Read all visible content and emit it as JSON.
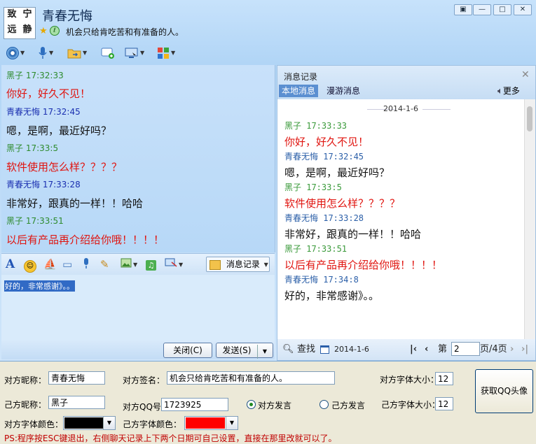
{
  "window": {
    "avatar_chars": [
      "致",
      "宁",
      "远",
      "静"
    ],
    "contact_name": "青春无悔",
    "contact_signature": "机会只给肯吃苦和有准备的人。",
    "controls": [
      "▣",
      "—",
      "□",
      "✕"
    ]
  },
  "toolbar": {
    "icons": [
      "camera-icon",
      "microphone-icon",
      "file-transfer-icon",
      "sms-icon",
      "remote-desktop-icon",
      "apps-icon"
    ]
  },
  "chat": {
    "messages": [
      {
        "meta": "黑子 17:32:33",
        "text": "你好，好久不见！",
        "meta_color": "#2e8b2e",
        "text_color": "#e0140f"
      },
      {
        "meta": "青春无悔 17:32:45",
        "text": "嗯，是啊，最近好吗？",
        "meta_color": "#1a2fb0",
        "text_color": "#111111"
      },
      {
        "meta": "黑子 17:33:5",
        "text": "软件使用怎么样？？？？",
        "meta_color": "#2e8b2e",
        "text_color": "#e0140f"
      },
      {
        "meta": "青春无悔 17:33:28",
        "text": "非常好，跟真的一样！！哈哈",
        "meta_color": "#1a2fb0",
        "text_color": "#111111"
      },
      {
        "meta": "黑子 17:33:51",
        "text": "以后有产品再介绍给你哦！！！！",
        "meta_color": "#2e8b2e",
        "text_color": "#e0140f"
      }
    ],
    "message_record_label": "消息记录",
    "input_text": "好的，非常感谢》。。",
    "close_label": "关闭(C)",
    "send_label": "发送(S)"
  },
  "history": {
    "title": "消息记录",
    "tab_local": "本地消息",
    "tab_roam": "漫游消息",
    "more": "更多",
    "date": "2014-1-6",
    "messages": [
      {
        "meta": "黑子  17:33:33",
        "text": "你好，好久不见！",
        "meta_color": "#3a9a3a",
        "text_color": "#e0140f"
      },
      {
        "meta": "青春无悔  17:32:45",
        "text": "嗯，是啊，最近好吗？",
        "meta_color": "#2b5fa8",
        "text_color": "#111111"
      },
      {
        "meta": "黑子  17:33:5",
        "text": "软件使用怎么样？？？？",
        "meta_color": "#3a9a3a",
        "text_color": "#e0140f"
      },
      {
        "meta": "青春无悔  17:33:28",
        "text": "非常好，跟真的一样！！哈哈",
        "meta_color": "#2b5fa8",
        "text_color": "#111111"
      },
      {
        "meta": "黑子  17:33:51",
        "text": "以后有产品再介绍给你哦！！！！",
        "meta_color": "#3a9a3a",
        "text_color": "#e0140f"
      },
      {
        "meta": "青春无悔  17:34:8",
        "text": "好的，非常感谢》。。",
        "meta_color": "#2b5fa8",
        "text_color": "#111111"
      }
    ],
    "footer": {
      "search": "查找",
      "date": "2014-1-6",
      "page_prefix": "第",
      "page": "2",
      "page_suffix": "页/4页"
    }
  },
  "form": {
    "peer_nick_label": "对方昵称：",
    "peer_nick": "青春无悔",
    "peer_sig_label": "对方签名：",
    "peer_sig": "机会只给肯吃苦和有准备的人。",
    "peer_font_size_label": "对方字体大小：",
    "peer_font_size": "12",
    "self_nick_label": "己方昵称：",
    "self_nick": "黑子",
    "peer_qq_label": "对方QQ号：",
    "peer_qq": "1723925",
    "radio_peer": "对方发言",
    "radio_self": "己方发言",
    "self_font_size_label": "己方字体大小：",
    "self_font_size": "12",
    "peer_color_label": "对方字体颜色：",
    "peer_color": "#000000",
    "self_color_label": "己方字体颜色：",
    "self_color": "#ff0000",
    "get_avatar": "获取QQ头像",
    "ps": "PS:程序按ESC键退出，右侧聊天记录上下两个日期可自己设置，直接在那里改就可以了。"
  }
}
